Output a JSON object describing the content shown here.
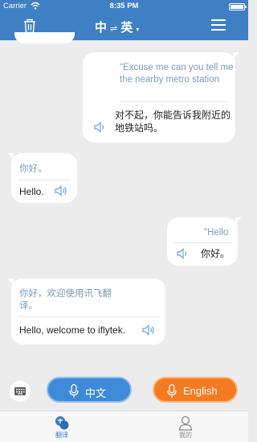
{
  "status_bar": {
    "carrier": "Carrier",
    "time": "8:35 PM"
  },
  "header": {
    "lang_from": "中",
    "swap_glyph": "⇌",
    "lang_to": "英",
    "caret": "▾"
  },
  "messages": [
    {
      "side": "right",
      "source": "\"Excuse me can you tell me the nearby metro station",
      "translation": "对不起，你能告诉我附近的地铁站吗。"
    },
    {
      "side": "left",
      "source": "你好。",
      "translation": "Hello."
    },
    {
      "side": "right",
      "source": "\"Hello",
      "translation": "你好。"
    },
    {
      "side": "left",
      "source": "你好，欢迎使用讯飞翻译。",
      "translation": "Hello, welcome to iflytek."
    }
  ],
  "input_bar": {
    "chinese_button": "中文",
    "english_button": "English"
  },
  "tabs": {
    "translate": "翻译",
    "me": "我的"
  },
  "colors": {
    "primary_blue": "#3f7fc3",
    "chinese_pill": "#3d8ad8",
    "english_pill": "#f57b21",
    "source_text": "#7b9bb8"
  }
}
